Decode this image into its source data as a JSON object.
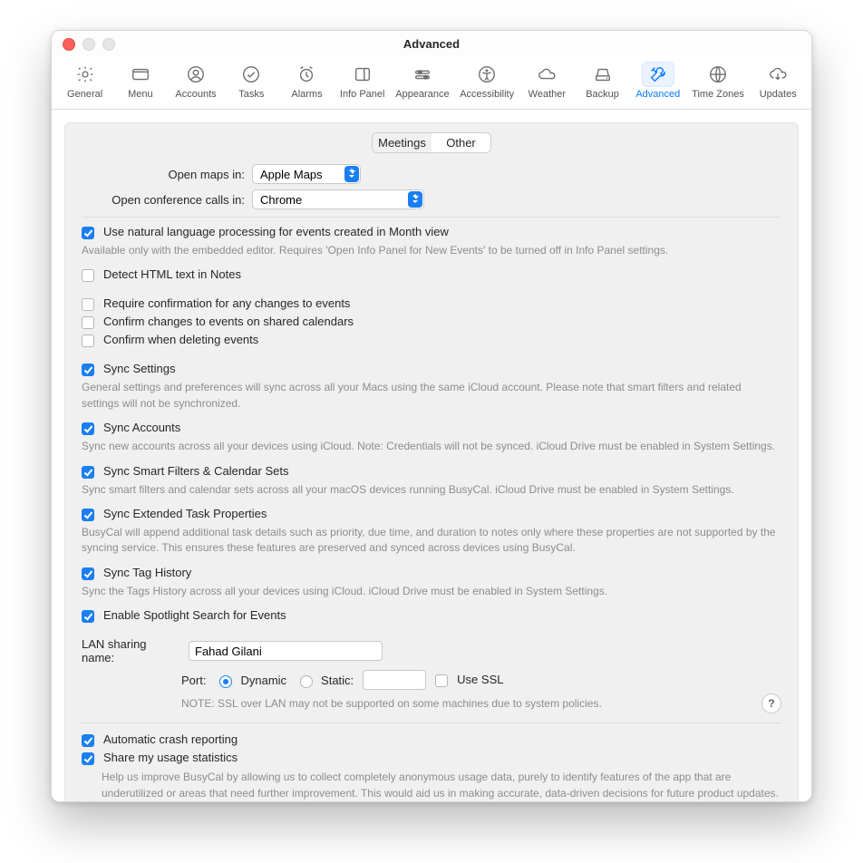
{
  "window": {
    "title": "Advanced"
  },
  "toolbar": {
    "items": [
      {
        "id": "general",
        "label": "General"
      },
      {
        "id": "menu",
        "label": "Menu"
      },
      {
        "id": "accounts",
        "label": "Accounts"
      },
      {
        "id": "tasks",
        "label": "Tasks"
      },
      {
        "id": "alarms",
        "label": "Alarms"
      },
      {
        "id": "infopanel",
        "label": "Info Panel"
      },
      {
        "id": "appearance",
        "label": "Appearance"
      },
      {
        "id": "accessibility",
        "label": "Accessibility"
      },
      {
        "id": "weather",
        "label": "Weather"
      },
      {
        "id": "backup",
        "label": "Backup"
      },
      {
        "id": "advanced",
        "label": "Advanced"
      },
      {
        "id": "timezones",
        "label": "Time Zones"
      },
      {
        "id": "updates",
        "label": "Updates"
      }
    ],
    "selected": "advanced"
  },
  "tabs": {
    "meetings": "Meetings",
    "other": "Other",
    "active": "other"
  },
  "rows": {
    "open_maps_label": "Open maps in:",
    "open_maps_value": "Apple Maps",
    "open_conf_label": "Open conference calls in:",
    "open_conf_value": "Chrome"
  },
  "nlp": {
    "label": "Use natural language processing for events created in Month view",
    "checked": true,
    "hint": "Available only with the embedded editor. Requires 'Open Info Panel for New Events' to be turned off in Info Panel settings."
  },
  "detect_html": {
    "label": "Detect HTML text in Notes",
    "checked": false
  },
  "confirm": {
    "require_changes": {
      "label": "Require confirmation for any changes to events",
      "checked": false
    },
    "changes_shared": {
      "label": "Confirm changes to events on shared calendars",
      "checked": false
    },
    "on_delete": {
      "label": "Confirm when deleting events",
      "checked": false
    }
  },
  "sync": {
    "settings": {
      "label": "Sync Settings",
      "checked": true,
      "hint": "General settings and preferences will sync across all your Macs using the same iCloud account. Please note that smart filters and related settings will not be synchronized."
    },
    "accounts": {
      "label": "Sync Accounts",
      "checked": true,
      "hint": "Sync new accounts across all your devices using iCloud. Note: Credentials will not be synced. iCloud Drive must be enabled in System Settings."
    },
    "smart": {
      "label": "Sync Smart Filters & Calendar Sets",
      "checked": true,
      "hint": "Sync smart filters and calendar sets across all your macOS devices running BusyCal. iCloud Drive must be enabled in System Settings."
    },
    "extended": {
      "label": "Sync Extended Task Properties",
      "checked": true,
      "hint": "BusyCal will append additional task details such as priority, due time, and duration to notes only where these properties are not supported by the syncing service. This ensures these features are preserved and synced across devices using BusyCal."
    },
    "tags": {
      "label": "Sync Tag History",
      "checked": true,
      "hint": "Sync the Tags History across all your devices using iCloud. iCloud Drive must be enabled in System Settings."
    }
  },
  "spotlight": {
    "label": "Enable Spotlight Search for Events",
    "checked": true
  },
  "lan": {
    "label": "LAN sharing name:",
    "name_value": "Fahad Gilani",
    "port_label": "Port:",
    "dynamic_label": "Dynamic",
    "static_label": "Static:",
    "static_value": "",
    "use_ssl_label": "Use SSL",
    "port_mode": "dynamic",
    "use_ssl_checked": false,
    "note": "NOTE: SSL over LAN may not be supported on some machines due to system policies.",
    "help": "?"
  },
  "crash": {
    "label": "Automatic crash reporting",
    "checked": true
  },
  "usage": {
    "label": "Share my usage statistics",
    "checked": true,
    "hint": "Help us improve BusyCal by allowing us to collect completely anonymous usage data, purely to identify features of the app that are underutilized or areas that need further improvement. This would aid us in making accurate, data-driven decisions for future product updates."
  }
}
